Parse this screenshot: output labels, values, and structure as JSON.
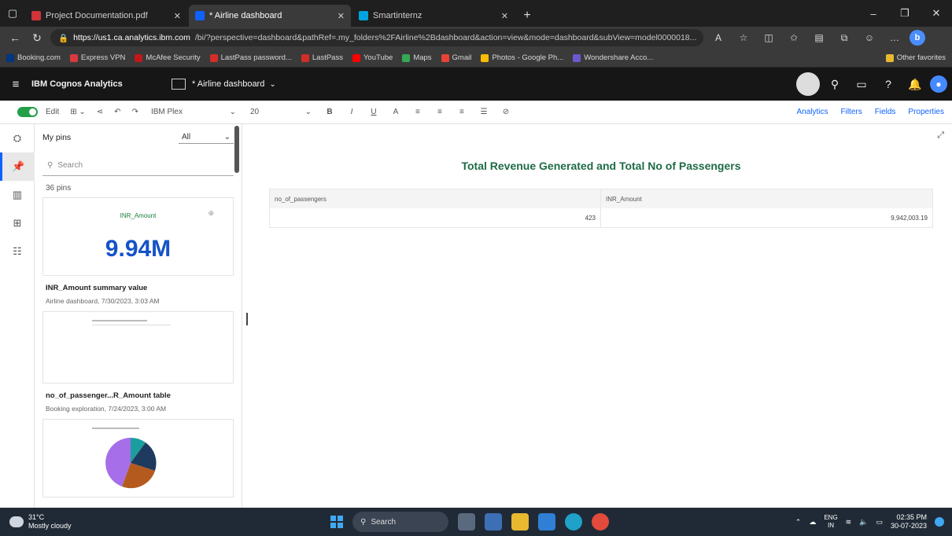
{
  "browser": {
    "tabs": [
      {
        "title": "Project Documentation.pdf",
        "active": false,
        "color": "#d13438"
      },
      {
        "title": "* Airline dashboard",
        "active": true,
        "color": "#0f62fe"
      },
      {
        "title": "Smartinternz",
        "active": false,
        "color": "#00a3e0"
      }
    ],
    "url_host": "https://us1.ca.analytics.ibm.com",
    "url_rest": "/bi/?perspective=dashboard&pathRef=.my_folders%2FAirline%2Bdashboard&action=view&mode=dashboard&subView=model0000018...",
    "bookmarks": [
      {
        "label": "Booking.com",
        "color": "#003580"
      },
      {
        "label": "Express VPN",
        "color": "#da3940"
      },
      {
        "label": "McAfee Security",
        "color": "#c01818"
      },
      {
        "label": "LastPass password...",
        "color": "#d32d27"
      },
      {
        "label": "LastPass",
        "color": "#d32d27"
      },
      {
        "label": "YouTube",
        "color": "#ff0000"
      },
      {
        "label": "Maps",
        "color": "#34a853"
      },
      {
        "label": "Gmail",
        "color": "#ea4335"
      },
      {
        "label": "Photos - Google Ph...",
        "color": "#fbbc04"
      },
      {
        "label": "Wondershare Acco...",
        "color": "#6a5acd"
      }
    ],
    "other_favorites": "Other favorites"
  },
  "app": {
    "brand": "IBM Cognos Analytics",
    "dashboard_name": "* Airline dashboard"
  },
  "toolbar": {
    "edit_label": "Edit",
    "font": "IBM Plex",
    "size": "20",
    "analytics": "Analytics",
    "filters": "Filters",
    "fields": "Fields",
    "properties": "Properties"
  },
  "pins": {
    "title": "My pins",
    "filter": "All",
    "search_placeholder": "Search",
    "count": "36 pins",
    "kpi_label": "INR_Amount",
    "kpi_value": "9.94M",
    "items": [
      {
        "title": "INR_Amount summary value",
        "meta": "Airline dashboard, 7/30/2023, 3:03 AM"
      },
      {
        "title": "no_of_passenger...R_Amount table",
        "meta": "Booking exploration, 7/24/2023, 3:00 AM"
      }
    ]
  },
  "visualization": {
    "title": "Total Revenue Generated and Total No of Passengers",
    "columns": [
      "no_of_passengers",
      "INR_Amount"
    ],
    "row": [
      "423",
      "9,942,003.19"
    ]
  },
  "taskbar": {
    "temp": "31°C",
    "weather": "Mostly cloudy",
    "search": "Search",
    "lang1": "ENG",
    "lang2": "IN",
    "time": "02:35 PM",
    "date": "30-07-2023"
  },
  "colors": {
    "accent": "#0f62fe",
    "title_green": "#1f6b47",
    "kpi_blue": "#1553c7",
    "pie": [
      "#1b9e9e",
      "#1e3a5f",
      "#b55a1e",
      "#a66ee8"
    ]
  }
}
